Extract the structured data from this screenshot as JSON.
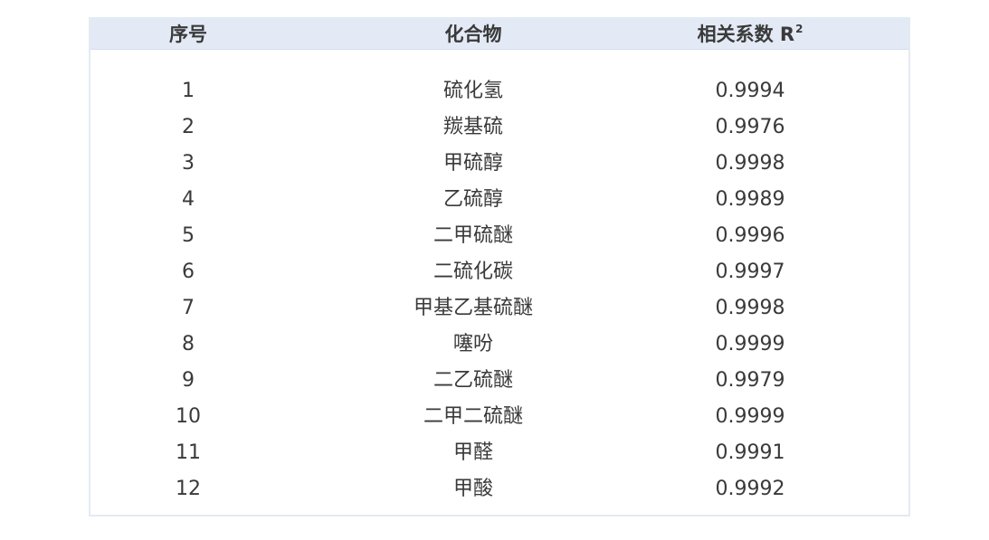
{
  "table": {
    "headers": {
      "index": "序号",
      "compound": "化合物",
      "r2_label": "相关系数 R",
      "r2_sup": "2"
    },
    "rows": [
      {
        "index": "1",
        "compound": "硫化氢",
        "r2": "0.9994"
      },
      {
        "index": "2",
        "compound": "羰基硫",
        "r2": "0.9976"
      },
      {
        "index": "3",
        "compound": "甲硫醇",
        "r2": "0.9998"
      },
      {
        "index": "4",
        "compound": "乙硫醇",
        "r2": "0.9989"
      },
      {
        "index": "5",
        "compound": "二甲硫醚",
        "r2": "0.9996"
      },
      {
        "index": "6",
        "compound": "二硫化碳",
        "r2": "0.9997"
      },
      {
        "index": "7",
        "compound": "甲基乙基硫醚",
        "r2": "0.9998"
      },
      {
        "index": "8",
        "compound": "噻吩",
        "r2": "0.9999"
      },
      {
        "index": "9",
        "compound": "二乙硫醚",
        "r2": "0.9979"
      },
      {
        "index": "10",
        "compound": "二甲二硫醚",
        "r2": "0.9999"
      },
      {
        "index": "11",
        "compound": "甲醛",
        "r2": "0.9991"
      },
      {
        "index": "12",
        "compound": "甲酸",
        "r2": "0.9992"
      }
    ]
  }
}
